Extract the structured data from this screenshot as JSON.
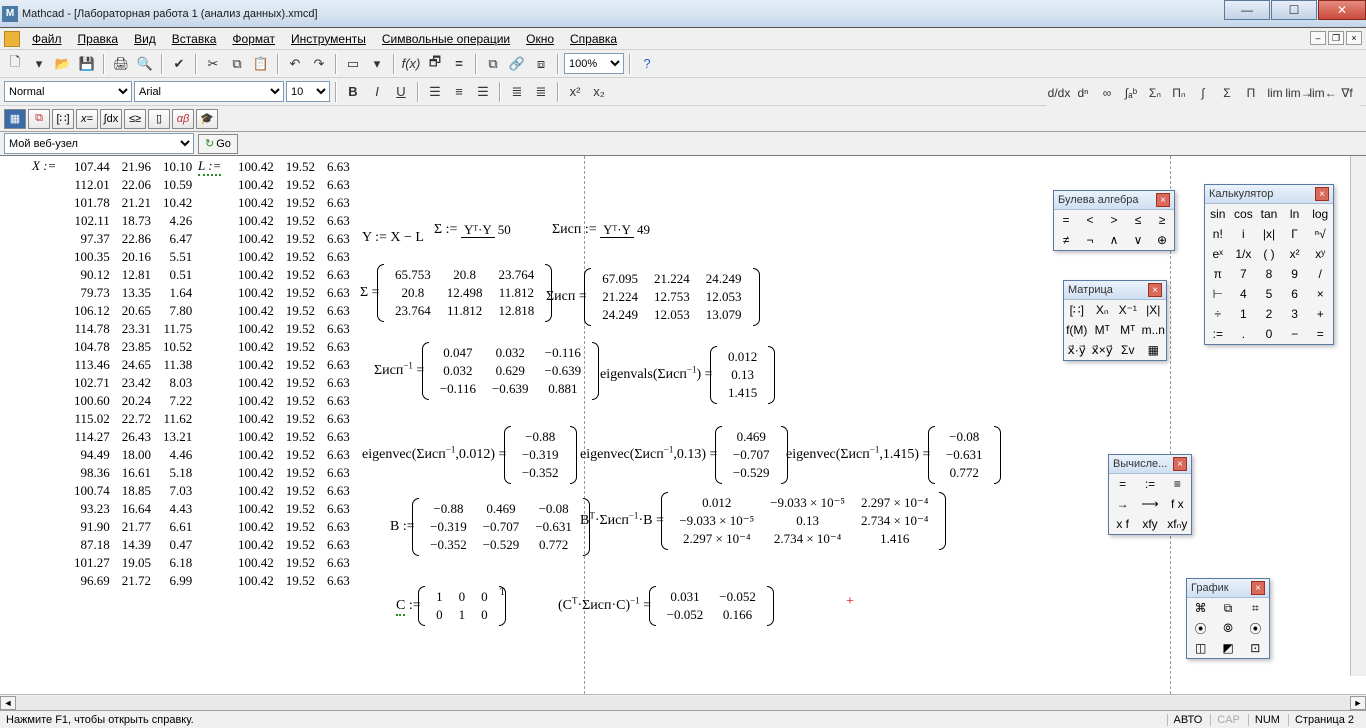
{
  "title": "Mathcad - [Лабораторная работа 1 (анализ данных).xmcd]",
  "menu": [
    "Файл",
    "Правка",
    "Вид",
    "Вставка",
    "Формат",
    "Инструменты",
    "Символьные операции",
    "Окно",
    "Справка"
  ],
  "toolbar1": {
    "zoom": "100%"
  },
  "toolbar2": {
    "style": "Normal",
    "font": "Arial",
    "size": "10"
  },
  "webrow": {
    "site": "Мой веб-узел",
    "go": "Go"
  },
  "X_label": "X :=",
  "L_label": "L :=",
  "X_data": [
    [
      107.44,
      21.96,
      10.1
    ],
    [
      112.01,
      22.06,
      10.59
    ],
    [
      101.78,
      21.21,
      10.42
    ],
    [
      102.11,
      18.73,
      4.26
    ],
    [
      97.37,
      22.86,
      6.47
    ],
    [
      100.35,
      20.16,
      5.51
    ],
    [
      90.12,
      12.81,
      0.51
    ],
    [
      79.73,
      13.35,
      1.64
    ],
    [
      106.12,
      20.65,
      7.8
    ],
    [
      114.78,
      23.31,
      11.75
    ],
    [
      104.78,
      23.85,
      10.52
    ],
    [
      113.46,
      24.65,
      11.38
    ],
    [
      102.71,
      23.42,
      8.03
    ],
    [
      100.6,
      20.24,
      7.22
    ],
    [
      115.02,
      22.72,
      11.62
    ],
    [
      114.27,
      26.43,
      13.21
    ],
    [
      94.49,
      18.0,
      4.46
    ],
    [
      98.36,
      16.61,
      5.18
    ],
    [
      100.74,
      18.85,
      7.03
    ],
    [
      93.23,
      16.64,
      4.43
    ],
    [
      91.9,
      21.77,
      6.61
    ],
    [
      87.18,
      14.39,
      0.47
    ],
    [
      101.27,
      19.05,
      6.18
    ],
    [
      96.69,
      21.72,
      6.99
    ]
  ],
  "L_data_row": [
    100.42,
    19.52,
    6.63
  ],
  "L_rows": 24,
  "eq": {
    "Y": "Y := X − L",
    "Sigma_label": "Σ :=",
    "Sigma_frac_num": "Yᵀ·Y",
    "Sigma_frac_den": "50",
    "Sisp_label": "Σисп :=",
    "Sisp_frac_num": "Yᵀ·Y",
    "Sisp_frac_den": "49",
    "Sigma_eq": "Σ =",
    "Sigma_mat": [
      [
        65.753,
        20.8,
        23.764
      ],
      [
        20.8,
        12.498,
        11.812
      ],
      [
        23.764,
        11.812,
        12.818
      ]
    ],
    "Sisp_eq": "Σисп =",
    "Sisp_mat": [
      [
        67.095,
        21.224,
        24.249
      ],
      [
        21.224,
        12.753,
        12.053
      ],
      [
        24.249,
        12.053,
        13.079
      ]
    ],
    "SispInv_label": "Σисп⁻¹ =",
    "SispInv_mat": [
      [
        "0.047",
        "0.032",
        "−0.116"
      ],
      [
        "0.032",
        "0.629",
        "−0.639"
      ],
      [
        "−0.116",
        "−0.639",
        "0.881"
      ]
    ],
    "eigvals_label": "eigenvals(Σисп⁻¹) =",
    "eigvals": [
      0.012,
      0.13,
      1.415
    ],
    "ev1_label": "eigenvec(Σисп⁻¹,0.012) =",
    "ev1": [
      "−0.88",
      "−0.319",
      "−0.352"
    ],
    "ev2_label": "eigenvec(Σисп⁻¹,0.13) =",
    "ev2": [
      "0.469",
      "−0.707",
      "−0.529"
    ],
    "ev3_label": "eigenvec(Σисп⁻¹,1.415) =",
    "ev3": [
      "−0.08",
      "−0.631",
      "0.772"
    ],
    "B_label": "B :=",
    "B_mat": [
      [
        "−0.88",
        "0.469",
        "−0.08"
      ],
      [
        "−0.319",
        "−0.707",
        "−0.631"
      ],
      [
        "−0.352",
        "−0.529",
        "0.772"
      ]
    ],
    "BTB_label": "Bᵀ·Σисп⁻¹·B =",
    "BTB_mat": [
      [
        "0.012",
        "−9.033 × 10⁻⁵",
        "2.297 × 10⁻⁴"
      ],
      [
        "−9.033 × 10⁻⁵",
        "0.13",
        "2.734 × 10⁻⁴"
      ],
      [
        "2.297 × 10⁻⁴",
        "2.734 × 10⁻⁴",
        "1.416"
      ]
    ],
    "C_label": "C :=",
    "C_mat": [
      [
        "1",
        "0",
        "0"
      ],
      [
        "0",
        "1",
        "0"
      ]
    ],
    "C_sup": "T",
    "CTC_label": "(Cᵀ·Σисп·C)⁻¹ =",
    "CTC_mat": [
      [
        "0.031",
        "−0.052"
      ],
      [
        "−0.052",
        "0.166"
      ]
    ]
  },
  "palettes": {
    "bool": {
      "title": "Булева алгебра",
      "cells": [
        "=",
        "<",
        ">",
        "≤",
        "≥",
        "≠",
        "¬",
        "∧",
        "∨",
        "⊕"
      ]
    },
    "matrix": {
      "title": "Матрица",
      "cells": [
        "[∷]",
        "Xₙ",
        "X⁻¹",
        "|X|",
        "f(M)",
        "Mᵀ",
        "Mᵀ",
        "m..n",
        "x⃗·y⃗",
        "x⃗×y⃗",
        "Σv",
        "▦"
      ]
    },
    "calc": {
      "title": "Калькулятор",
      "cells": [
        "sin",
        "cos",
        "tan",
        "ln",
        "log",
        "n!",
        "i",
        "|x|",
        "Γ",
        "ⁿ√",
        "eˣ",
        "1/x",
        "( )",
        "x²",
        "xʸ",
        "π",
        "7",
        "8",
        "9",
        "/",
        "⊢",
        "4",
        "5",
        "6",
        "×",
        "÷",
        "1",
        "2",
        "3",
        "+",
        ":=",
        ".",
        "0",
        "−",
        "="
      ]
    },
    "eval": {
      "title": "Вычисле...",
      "cells": [
        "=",
        ":=",
        "≡",
        "→",
        "⟶",
        "f x",
        "x f",
        "xfy",
        "xfₙy"
      ]
    },
    "graph": {
      "title": "График",
      "cells": [
        "⌘",
        "⧉",
        "⌗",
        "⦿",
        "⦾",
        "⦿",
        "◫",
        "◩",
        "⊡"
      ]
    }
  },
  "status": {
    "hint": "Нажмите F1, чтобы открыть справку.",
    "auto": "АВТО",
    "cap": "CAP",
    "num": "NUM",
    "page": "Страница 2"
  }
}
